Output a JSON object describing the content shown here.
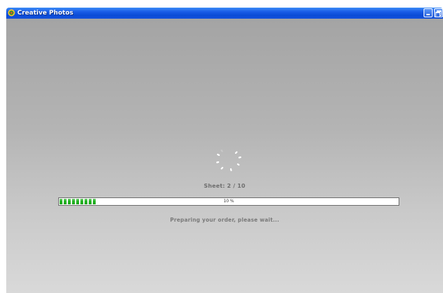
{
  "window": {
    "title": "Creative Photos"
  },
  "progress": {
    "sheet_label": "Sheet: 2 / 10",
    "percent_text": "10 %",
    "fraction": 0.1,
    "status": "Preparing your order, please wait..."
  },
  "icons": {
    "app": "creative-photos-icon",
    "minimize": "minimize-icon",
    "restore": "restore-icon",
    "spinner": "loading-spinner"
  },
  "colors": {
    "titlebar": "#0a4bd6",
    "progress_fill": "#22b322"
  }
}
